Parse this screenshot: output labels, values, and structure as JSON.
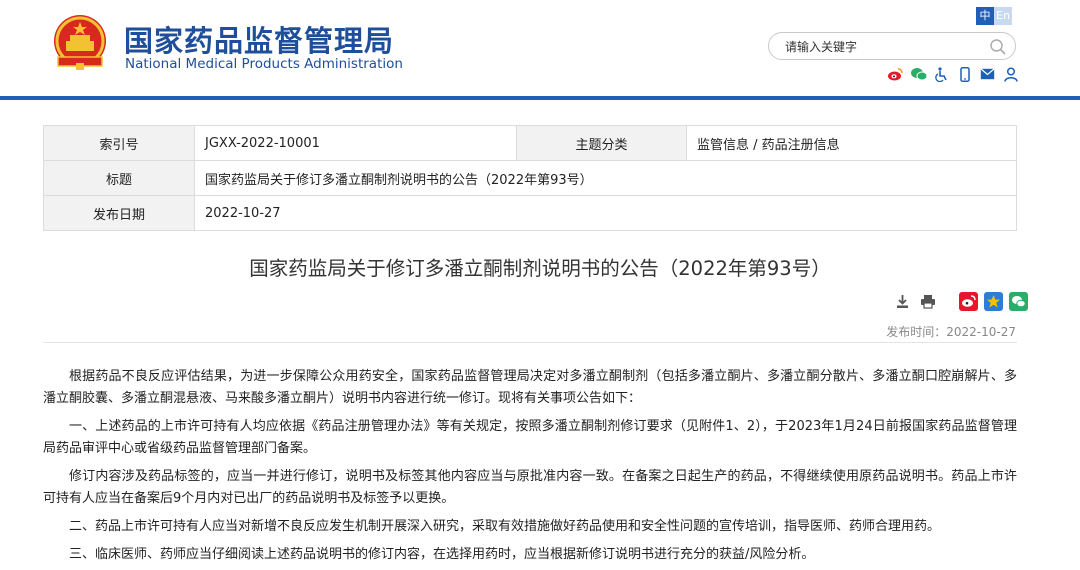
{
  "header": {
    "title_cn": "国家药品监督管理局",
    "title_en": "National Medical Products Administration",
    "lang": [
      "中",
      "En"
    ],
    "search_placeholder": "请输入关键字",
    "share_icons": [
      "weibo-icon",
      "wechat-icon",
      "accessibility-icon",
      "mobile-icon",
      "mail-icon",
      "user-icon"
    ],
    "rule_color": "#1f5fb8",
    "brand_color": "#1f4e9b"
  },
  "info": {
    "index_label": "索引号",
    "index_value": "JGXX-2022-10001",
    "category_label": "主题分类",
    "category_value": "监管信息 / 药品注册信息",
    "title_label": "标题",
    "title_value": "国家药监局关于修订多潘立酮制剂说明书的公告（2022年第93号）",
    "date_label": "发布日期",
    "date_value": "2022-10-27"
  },
  "article": {
    "title": "国家药监局关于修订多潘立酮制剂说明书的公告（2022年第93号）",
    "publish_label": "发布时间：",
    "publish_date": "2022-10-27",
    "tool_icons": [
      "download-icon",
      "print-icon",
      "weibo-share-icon",
      "qzone-share-icon",
      "wechat-share-icon"
    ],
    "paragraphs": [
      "根据药品不良反应评估结果，为进一步保障公众用药安全，国家药品监督管理局决定对多潘立酮制剂（包括多潘立酮片、多潘立酮分散片、多潘立酮口腔崩解片、多潘立酮胶囊、多潘立酮混悬液、马来酸多潘立酮片）说明书内容进行统一修订。现将有关事项公告如下：",
      "一、上述药品的上市许可持有人均应依据《药品注册管理办法》等有关规定，按照多潘立酮制剂修订要求（见附件1、2），于2023年1月24日前报国家药品监督管理局药品审评中心或省级药品监督管理部门备案。",
      "修订内容涉及药品标签的，应当一并进行修订，说明书及标签其他内容应当与原批准内容一致。在备案之日起生产的药品，不得继续使用原药品说明书。药品上市许可持有人应当在备案后9个月内对已出厂的药品说明书及标签予以更换。",
      "二、药品上市许可持有人应当对新增不良反应发生机制开展深入研究，采取有效措施做好药品使用和安全性问题的宣传培训，指导医师、药师合理用药。",
      "三、临床医师、药师应当仔细阅读上述药品说明书的修订内容，在选择用药时，应当根据新修订说明书进行充分的获益/风险分析。"
    ]
  }
}
